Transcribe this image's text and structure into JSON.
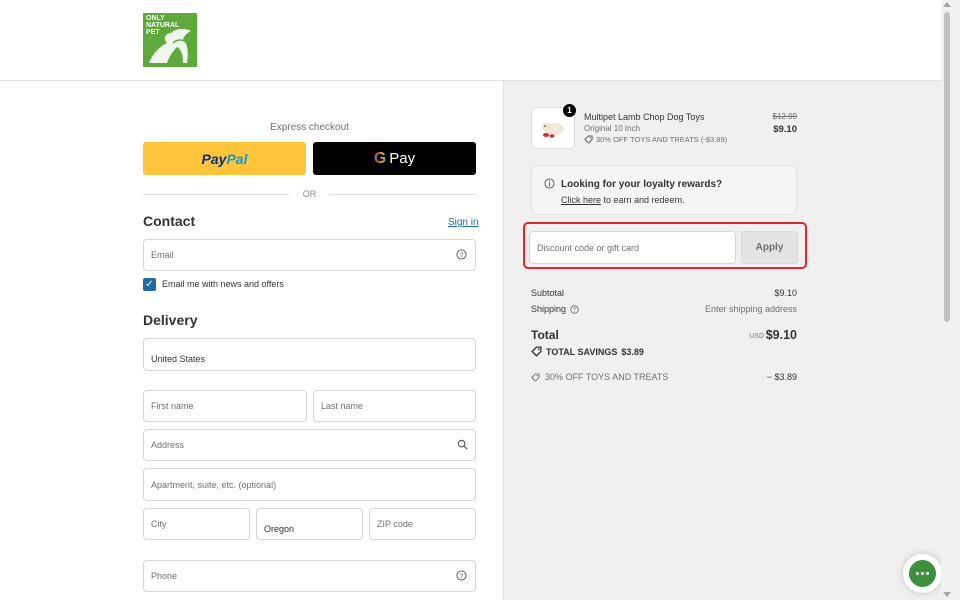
{
  "brand": {
    "logo_text": "ONLY NATURAL PET",
    "logo_color": "#5fa83c"
  },
  "express": {
    "label": "Express checkout",
    "paypal_pay": "Pay",
    "paypal_pal": "Pal",
    "gpay_g": "G",
    "gpay_label": "Pay",
    "or_text": "OR"
  },
  "contact": {
    "title": "Contact",
    "signin_label": "Sign in",
    "email_placeholder": "Email",
    "newsletter_label": "Email me with news and offers",
    "newsletter_checked": true
  },
  "delivery": {
    "title": "Delivery",
    "country": "United States",
    "first_name_placeholder": "First name",
    "last_name_placeholder": "Last name",
    "address_placeholder": "Address",
    "apartment_placeholder": "Apartment, suite, etc. (optional)",
    "city_placeholder": "City",
    "state": "Oregon",
    "zip_placeholder": "ZIP code",
    "phone_placeholder": "Phone"
  },
  "cart": {
    "item": {
      "quantity": "1",
      "title": "Multipet Lamb Chop Dog Toys",
      "variant": "Original 10 Inch",
      "discount_label": "30% OFF TOYS AND TREATS (-$3.89)",
      "compare_price": "$12.99",
      "price": "$9.10"
    },
    "loyalty": {
      "title": "Looking for your loyalty rewards?",
      "link": "Click here",
      "suffix": " to earn and redeem."
    },
    "discount": {
      "placeholder": "Discount code or gift card",
      "apply_label": "Apply"
    },
    "summary": {
      "subtotal_label": "Subtotal",
      "subtotal_value": "$9.10",
      "shipping_label": "Shipping",
      "shipping_value": "Enter shipping address",
      "total_label": "Total",
      "currency": "USD",
      "total_value": "$9.10",
      "savings_label": "TOTAL SAVINGS",
      "savings_value": "$3.89",
      "discount_name": "30% OFF TOYS AND TREATS",
      "discount_value": "− $3.89"
    }
  },
  "colors": {
    "paypal": "#ffc439",
    "gpay": "#000000",
    "link": "#1f6aa8",
    "highlight": "#e0262f",
    "chat": "#3d8f3d"
  }
}
